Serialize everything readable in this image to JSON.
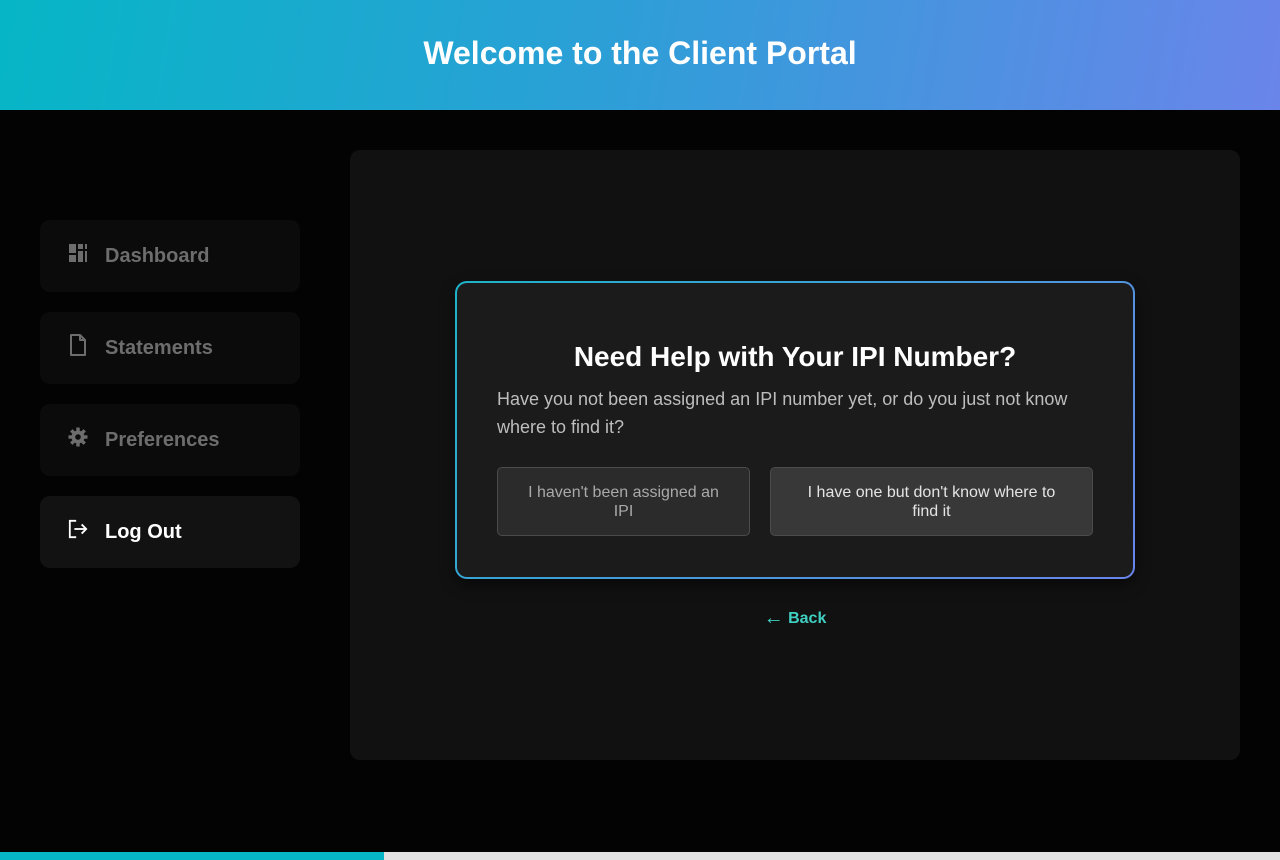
{
  "header": {
    "title": "Welcome to the Client Portal"
  },
  "sidebar": {
    "items": [
      {
        "label": "Dashboard",
        "icon": "dashboard-icon"
      },
      {
        "label": "Statements",
        "icon": "document-icon"
      },
      {
        "label": "Preferences",
        "icon": "gear-icon"
      },
      {
        "label": "Log Out",
        "icon": "logout-icon"
      }
    ]
  },
  "help_card": {
    "title": "Need Help with Your IPI Number?",
    "description": "Have you not been assigned an IPI number yet, or do you just not know where to find it?",
    "option_not_assigned": "I haven't been assigned an IPI",
    "option_dont_know": "I have one but don't know where to find it"
  },
  "back_link": {
    "arrow": "←",
    "label": "Back"
  },
  "progress": {
    "fraction": 0.3
  },
  "colors": {
    "accent": "#06b6c6",
    "gradient_end": "#6a85ea",
    "link": "#40d0c2",
    "background": "#030303"
  }
}
